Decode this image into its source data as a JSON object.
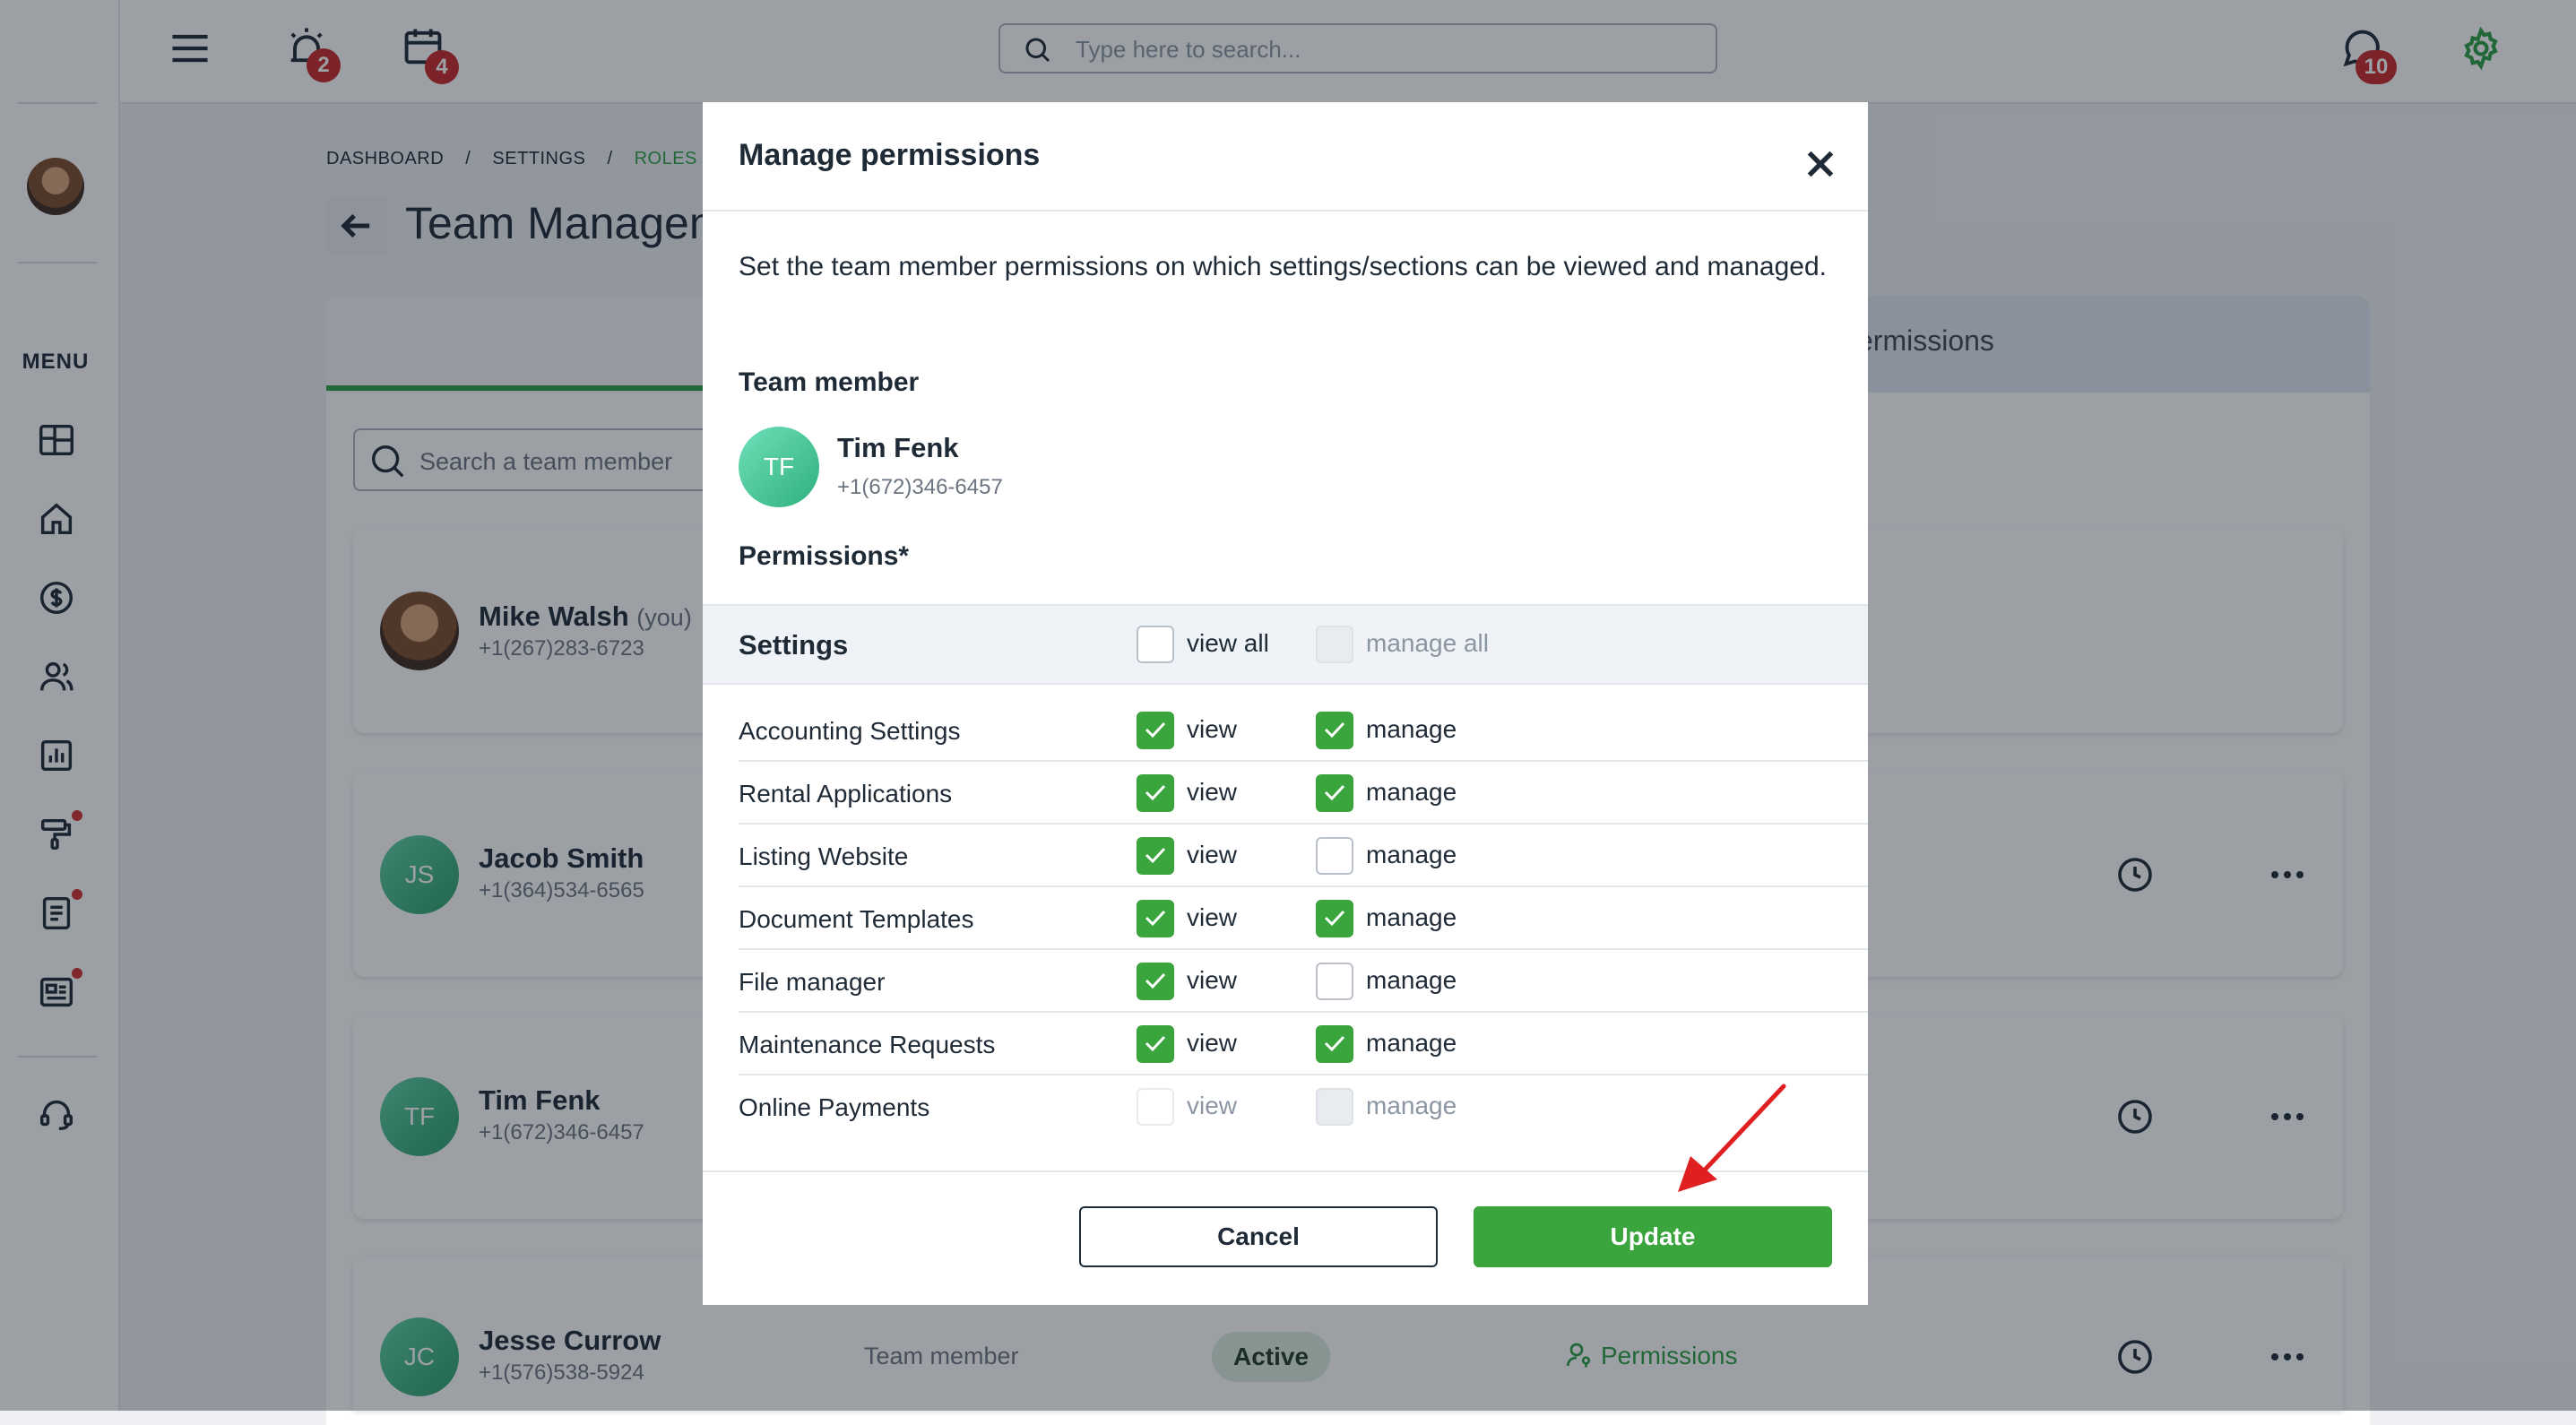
{
  "topbar": {
    "search_placeholder": "Type here to search...",
    "alarm_badge": "2",
    "calendar_badge": "4",
    "chat_badge": "10"
  },
  "sidebar": {
    "menu_label": "MENU"
  },
  "breadcrumb": {
    "items": [
      "DASHBOARD",
      "/",
      "SETTINGS",
      "/",
      "ROLES & PER"
    ]
  },
  "page": {
    "title": "Team Managem",
    "tab_right_label": "ermissions",
    "member_search_placeholder": "Search a team member"
  },
  "members": [
    {
      "name": "Mike Walsh",
      "you": "(you)",
      "phone": "+1(267)283-6723",
      "initials": ""
    },
    {
      "name": "Jacob Smith",
      "phone": "+1(364)534-6565",
      "initials": "JS"
    },
    {
      "name": "Tim Fenk",
      "phone": "+1(672)346-6457",
      "initials": "TF"
    },
    {
      "name": "Jesse Currow",
      "phone": "+1(576)538-5924",
      "initials": "JC",
      "role": "Team member",
      "status": "Active",
      "permissions_link": "Permissions"
    }
  ],
  "modal": {
    "title": "Manage permissions",
    "description": "Set the team member permissions on which settings/sections can be viewed and managed.",
    "team_member_label": "Team member",
    "team_member": {
      "initials": "TF",
      "name": "Tim Fenk",
      "phone": "+1(672)346-6457"
    },
    "permissions_label": "Permissions*",
    "section": {
      "title": "Settings",
      "view_all_label": "view all",
      "manage_all_label": "manage all"
    },
    "view_label": "view",
    "manage_label": "manage",
    "rows": [
      {
        "name": "Accounting Settings"
      },
      {
        "name": "Rental Applications"
      },
      {
        "name": "Listing Website"
      },
      {
        "name": "Document Templates"
      },
      {
        "name": "File manager"
      },
      {
        "name": "Maintenance Requests"
      },
      {
        "name": "Online Payments"
      }
    ],
    "cancel_label": "Cancel",
    "update_label": "Update"
  },
  "colors": {
    "accent": "#3aa43d",
    "badge": "#c62828"
  }
}
